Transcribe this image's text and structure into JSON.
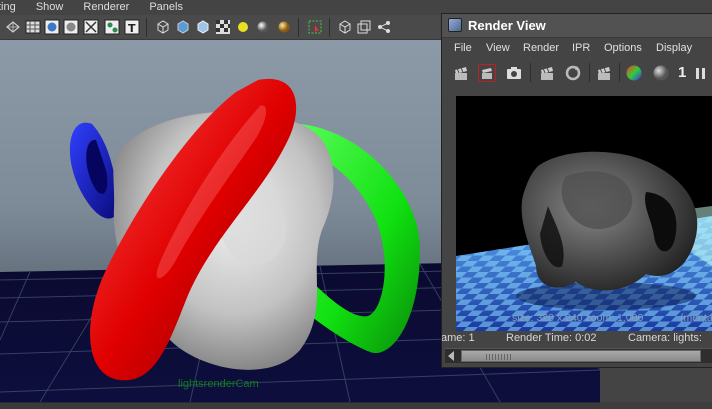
{
  "main_menu": {
    "items": [
      "ting",
      "Show",
      "Renderer",
      "Panels"
    ]
  },
  "viewport": {
    "camera_label": "lightsrenderCam"
  },
  "render_view": {
    "title": "Render View",
    "menu": [
      "File",
      "View",
      "Render",
      "IPR",
      "Options",
      "Display"
    ],
    "toolbar_value": "1",
    "overlay_info": "size: 320 x 240  zoom: 1.000",
    "overlay_renderer": "(mental",
    "status": {
      "frame": "ame: 1",
      "render_time": "Render Time: 0:02",
      "camera": "Camera: lights:"
    }
  },
  "colors": {
    "torus_red": "#ee1111",
    "torus_green": "#11ee11",
    "torus_blue": "#1122ee",
    "body_gray": "#c8c8c8",
    "hud_green": "#0e7c1a"
  }
}
